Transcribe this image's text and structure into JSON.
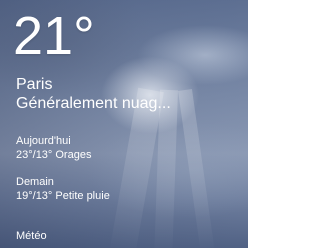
{
  "tile": {
    "app_name": "Météo",
    "current": {
      "temperature": "21°",
      "city": "Paris",
      "condition": "Généralement nuag..."
    },
    "forecast": [
      {
        "day": "Aujourd'hui",
        "summary": "23°/13° Orages"
      },
      {
        "day": "Demain",
        "summary": "19°/13° Petite pluie"
      }
    ]
  }
}
